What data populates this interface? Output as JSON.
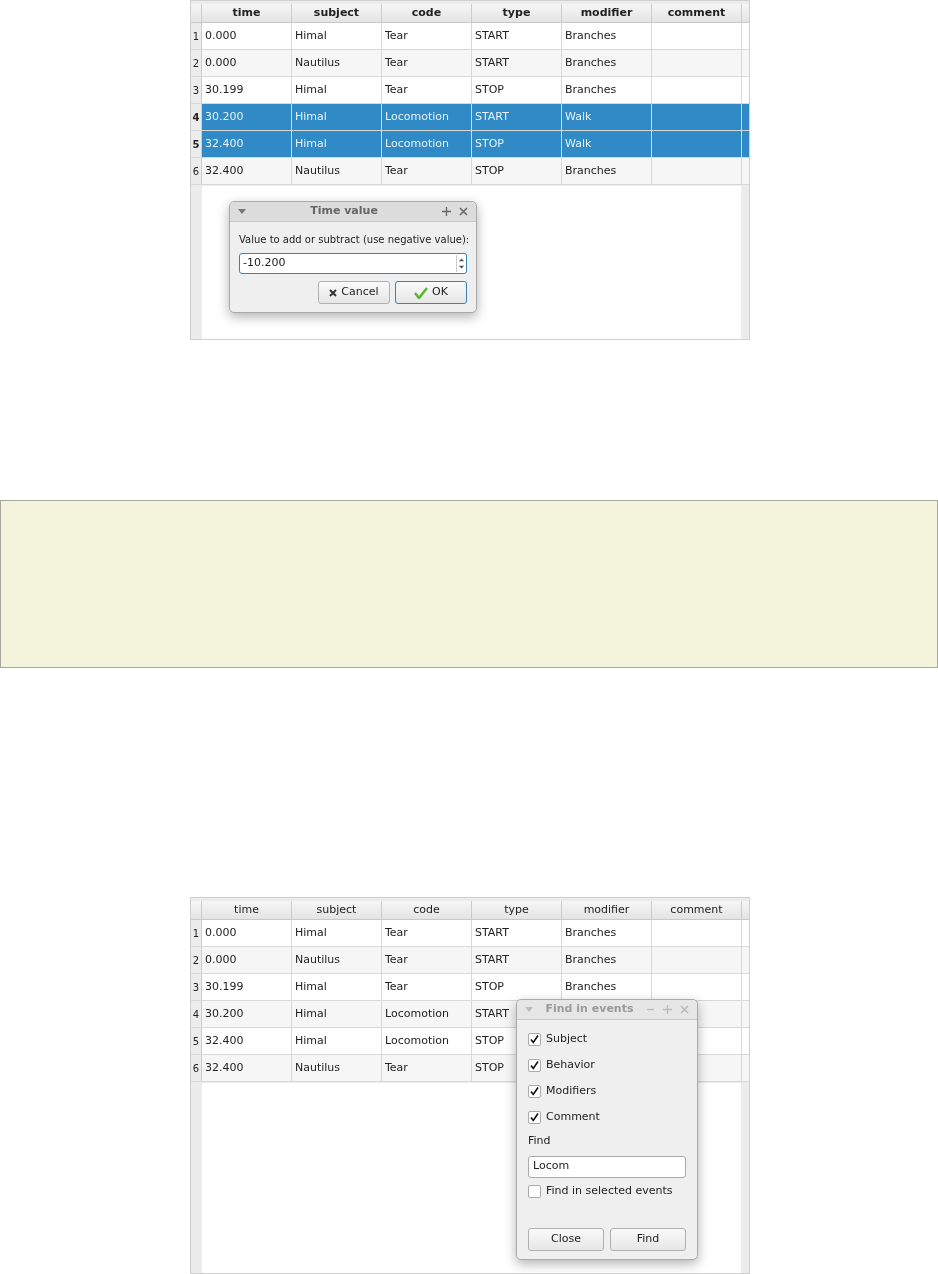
{
  "screenshots": [
    {
      "bold_headers": true,
      "columns": [
        "time",
        "subject",
        "code",
        "type",
        "modifier",
        "comment"
      ],
      "rows": [
        {
          "number": "1",
          "selected": false,
          "cells": [
            "0.000",
            "Himal",
            "Tear",
            "START",
            "Branches",
            ""
          ]
        },
        {
          "number": "2",
          "selected": false,
          "cells": [
            "0.000",
            "Nautilus",
            "Tear",
            "START",
            "Branches",
            ""
          ]
        },
        {
          "number": "3",
          "selected": false,
          "cells": [
            "30.199",
            "Himal",
            "Tear",
            "STOP",
            "Branches",
            ""
          ]
        },
        {
          "number": "4",
          "selected": true,
          "cells": [
            "30.200",
            "Himal",
            "Locomotion",
            "START",
            "Walk",
            ""
          ]
        },
        {
          "number": "5",
          "selected": true,
          "cells": [
            "32.400",
            "Himal",
            "Locomotion",
            "STOP",
            "Walk",
            ""
          ]
        },
        {
          "number": "6",
          "selected": false,
          "cells": [
            "32.400",
            "Nautilus",
            "Tear",
            "STOP",
            "Branches",
            ""
          ]
        }
      ],
      "dialog": {
        "kind": "time",
        "title": "Time value",
        "active": true,
        "label": "Value to add or subtract (use negative value):",
        "value": "-10.200",
        "buttons": [
          {
            "label": "Cancel",
            "kind": "cancel"
          },
          {
            "label": "OK",
            "kind": "ok"
          }
        ]
      }
    },
    {
      "bold_headers": false,
      "columns": [
        "time",
        "subject",
        "code",
        "type",
        "modifier",
        "comment"
      ],
      "rows": [
        {
          "number": "1",
          "selected": false,
          "cells": [
            "0.000",
            "Himal",
            "Tear",
            "START",
            "Branches",
            ""
          ]
        },
        {
          "number": "2",
          "selected": false,
          "cells": [
            "0.000",
            "Nautilus",
            "Tear",
            "START",
            "Branches",
            ""
          ]
        },
        {
          "number": "3",
          "selected": false,
          "cells": [
            "30.199",
            "Himal",
            "Tear",
            "STOP",
            "Branches",
            ""
          ]
        },
        {
          "number": "4",
          "selected": false,
          "cells": [
            "30.200",
            "Himal",
            "Locomotion",
            "START"
          ]
        },
        {
          "number": "5",
          "selected": false,
          "cells": [
            "32.400",
            "Himal",
            "Locomotion",
            "STOP"
          ]
        },
        {
          "number": "6",
          "selected": false,
          "cells": [
            "32.400",
            "Nautilus",
            "Tear",
            "STOP"
          ]
        }
      ],
      "dialog": {
        "kind": "find",
        "title": "Find in events",
        "active": false,
        "options": [
          {
            "label": "Subject",
            "checked": true
          },
          {
            "label": "Behavior",
            "checked": true
          },
          {
            "label": "Modifiers",
            "checked": true
          },
          {
            "label": "Comment",
            "checked": true
          }
        ],
        "find_label": "Find",
        "value": "Locom",
        "selected_only": {
          "label": "Find in selected events",
          "checked": false
        },
        "buttons": [
          {
            "label": "Close",
            "kind": "close"
          },
          {
            "label": "Find",
            "kind": "find"
          }
        ]
      }
    }
  ],
  "note": {
    "kind": "empty"
  }
}
